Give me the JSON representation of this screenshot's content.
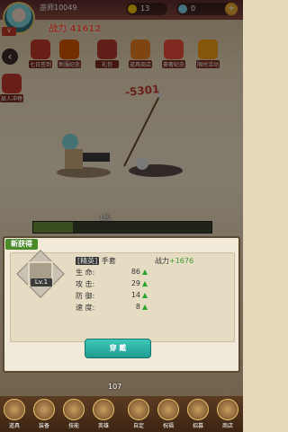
{
  "player": {
    "name": "巫师10049",
    "power": "战力 41612"
  },
  "resources": [
    {
      "name": "gold",
      "value": "13",
      "icon": "coin-icon",
      "color": "#f1c40f"
    },
    {
      "name": "gem",
      "value": "0",
      "icon": "diamond-icon",
      "color": "#7fd0e8"
    }
  ],
  "features": [
    "七日签到",
    "新服纪念",
    "礼包",
    "道具商店",
    "豪奢纪念",
    "限时活动"
  ],
  "side_label": "巫人冲榜",
  "damage": "-5301",
  "level_label": "1级",
  "popup": {
    "title": "新获得",
    "item": {
      "level": "Lv.1",
      "quality": "[精英]",
      "name": "手套"
    },
    "power_label": "战力",
    "power_gain": "+1676",
    "stats": [
      {
        "label": "生 命:",
        "value": "86"
      },
      {
        "label": "攻 击:",
        "value": "29"
      },
      {
        "label": "防 御:",
        "value": "14"
      },
      {
        "label": "速 度:",
        "value": "8"
      }
    ],
    "equip_button": "穿 戴"
  },
  "count": "107",
  "bottom_nav": [
    "道具",
    "装备",
    "技能",
    "英雄",
    "自定",
    "祝福",
    "招募",
    "商店"
  ]
}
